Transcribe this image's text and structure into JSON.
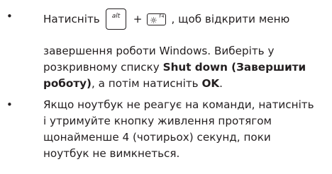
{
  "bullets": {
    "marker": "•"
  },
  "item1": {
    "press_text": "Натисніть",
    "alt_key_label": "alt",
    "plus": "+",
    "f4_key_label": "F4",
    "f4_key_icon": "brightness-down-icon",
    "after_keys_text": ", щоб відкрити меню",
    "line2": "завершення роботи Windows. Виберіть у",
    "line3_normal": "розкривному списку ",
    "line3_bold": "Shut down (Завершити",
    "line4_bold": "роботу)",
    "line4_middle": ", а потім натисніть ",
    "line4_bold_ok": "OK",
    "line4_end": "."
  },
  "item2": {
    "line1": "Якщо ноутбук не реагує на команди, натисніть",
    "line2": "і утримуйте кнопку живлення протягом",
    "line3": "щонайменше 4 (чотирьох) секунд, поки",
    "line4": "ноутбук не вимкнеться."
  },
  "colors": {
    "text": "#231f20",
    "background": "#ffffff"
  }
}
